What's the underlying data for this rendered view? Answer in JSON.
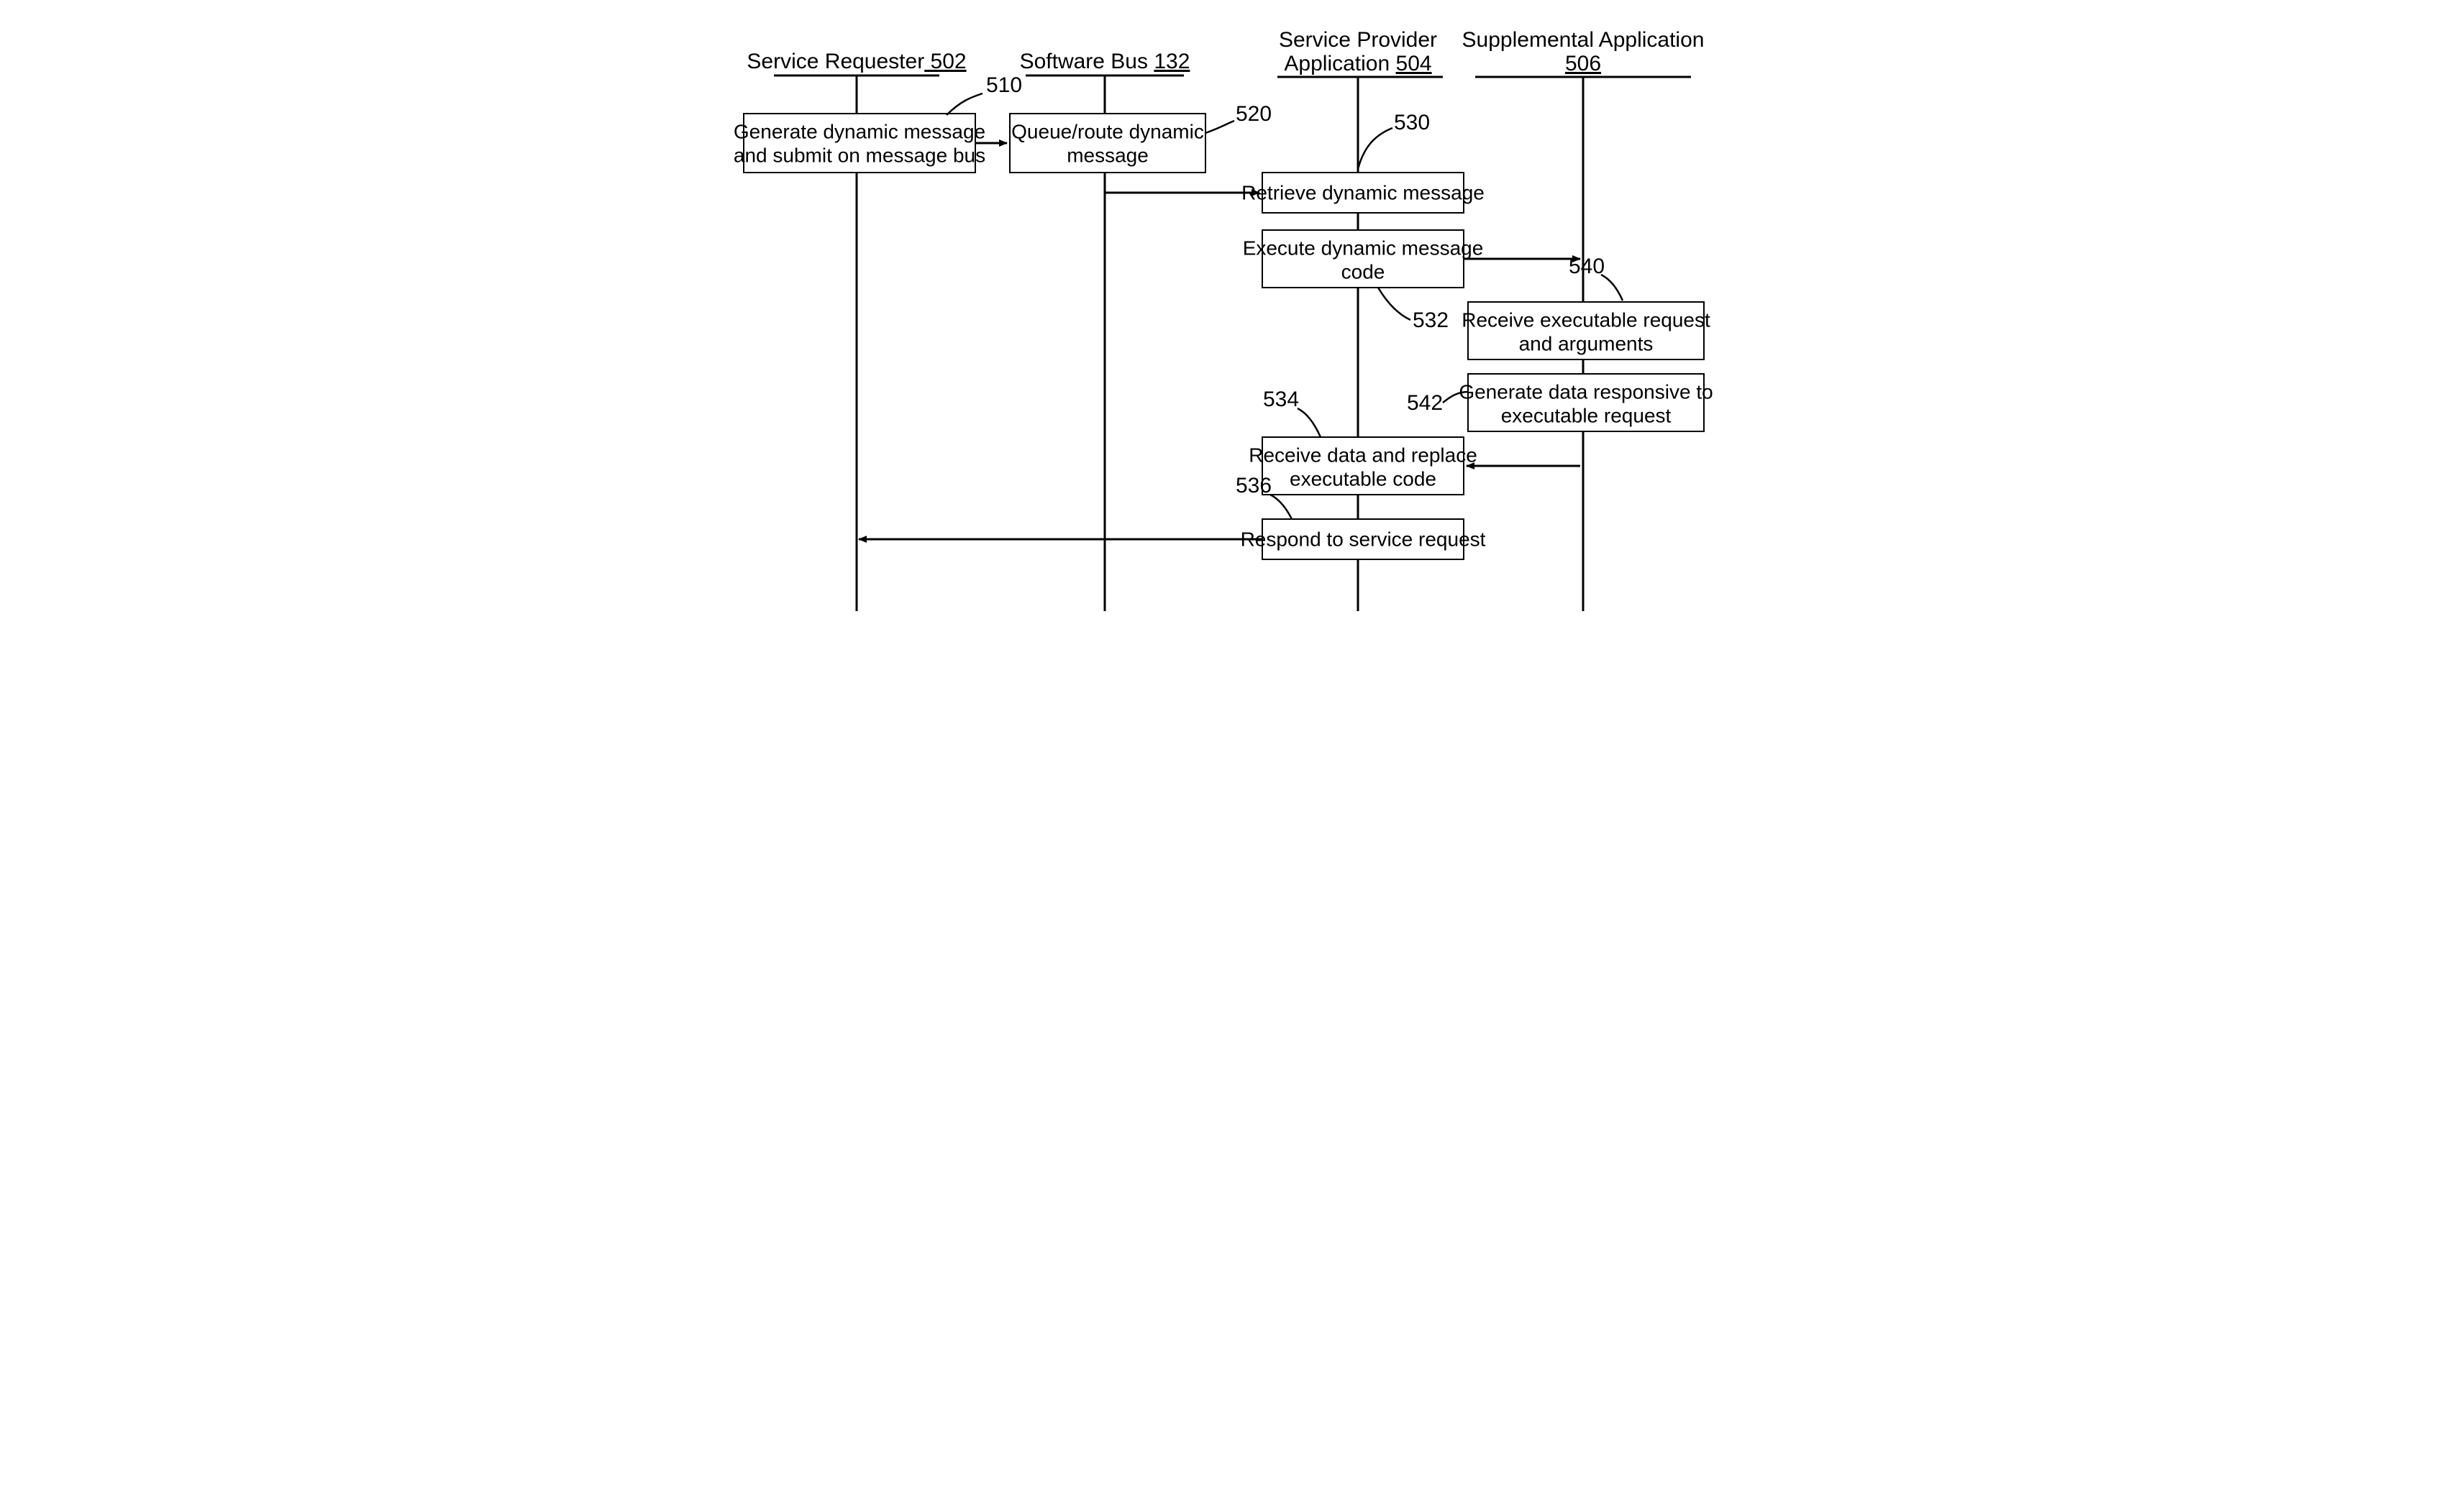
{
  "lanes": [
    {
      "title": "Service Requester",
      "num": " 502"
    },
    {
      "title": "Software Bus ",
      "num": "132"
    },
    {
      "title": "Service Provider Application ",
      "num": "504"
    },
    {
      "title": "Supplemental Application ",
      "num": "506"
    }
  ],
  "boxes": {
    "b510": {
      "line1": "Generate dynamic message",
      "line2": "and submit on message bus"
    },
    "b520": {
      "line1": "Queue/route dynamic",
      "line2": "message"
    },
    "b530": {
      "line1": "Retrieve dynamic message"
    },
    "b532": {
      "line1": "Execute dynamic message",
      "line2": "code"
    },
    "b540": {
      "line1": "Receive executable request",
      "line2": "and arguments"
    },
    "b542": {
      "line1": "Generate data responsive to",
      "line2": "executable request"
    },
    "b534": {
      "line1": "Receive data and replace",
      "line2": "executable code"
    },
    "b536": {
      "line1": "Respond to service request"
    }
  },
  "refs": {
    "r510": "510",
    "r520": "520",
    "r530": "530",
    "r532": "532",
    "r534": "534",
    "r536": "536",
    "r540": "540",
    "r542": "542"
  }
}
